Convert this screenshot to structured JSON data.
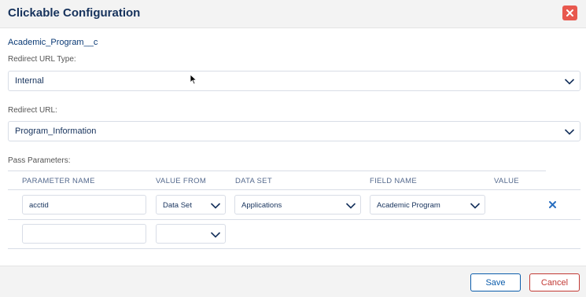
{
  "modal": {
    "title": "Clickable Configuration",
    "close_icon": "close-icon"
  },
  "object_name": "Academic_Program__c",
  "redirect_type": {
    "label": "Redirect URL Type:",
    "value": "Internal"
  },
  "redirect_url": {
    "label": "Redirect URL:",
    "value": "Program_Information"
  },
  "pass_params": {
    "label": "Pass Parameters:",
    "columns": [
      "PARAMETER NAME",
      "VALUE FROM",
      "DATA SET",
      "FIELD NAME",
      "VALUE"
    ],
    "rows": [
      {
        "parameter_name": "acctid",
        "value_from": "Data Set",
        "data_set": "Applications",
        "field_name": "Academic Program",
        "value": ""
      },
      {
        "parameter_name": "",
        "value_from": ""
      }
    ],
    "remove_icon": "remove-icon"
  },
  "footer": {
    "save_label": "Save",
    "cancel_label": "Cancel"
  }
}
